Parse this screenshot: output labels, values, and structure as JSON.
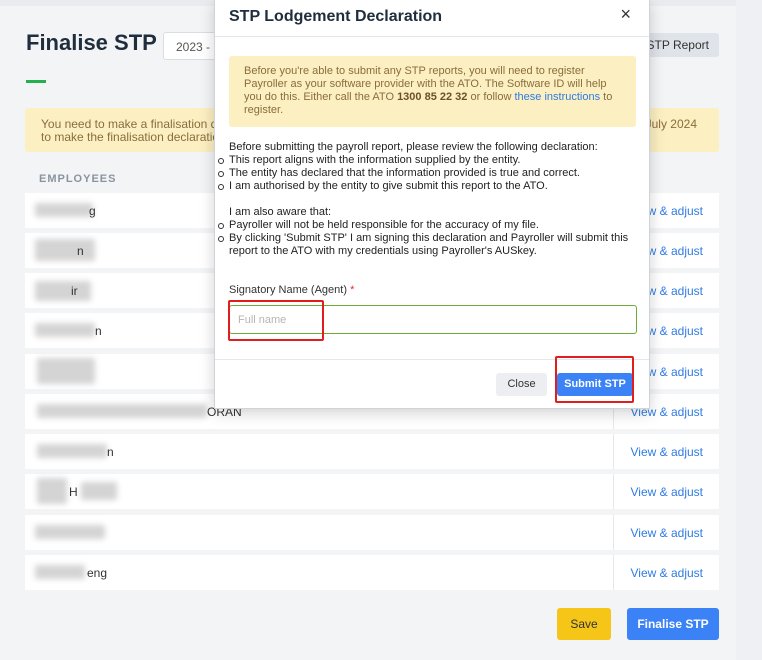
{
  "page": {
    "title": "Finalise STP",
    "year_select": "2023 -",
    "stp_report_label": "STP Report",
    "banner": {
      "line1": "You need to make a finalisation de",
      "line2": "to make the finalisation declaratio",
      "right_text": "July 2024"
    },
    "employees_header": "EMPLOYEES",
    "employees": [
      {
        "name": "g",
        "action": "View & adjust"
      },
      {
        "name": "n",
        "action": "View & adjust"
      },
      {
        "name": "ir",
        "action": "View & adjust"
      },
      {
        "name": "n",
        "action": "View & adjust"
      },
      {
        "name": "",
        "action": "View & adjust"
      },
      {
        "name": "ORAN",
        "action": "View & adjust"
      },
      {
        "name": "n",
        "action": "View & adjust"
      },
      {
        "name": "H",
        "action": "View & adjust"
      },
      {
        "name": "",
        "action": "View & adjust"
      },
      {
        "name": "eng",
        "action": "View & adjust"
      }
    ],
    "save_label": "Save",
    "finalise_label": "Finalise STP"
  },
  "modal": {
    "title": "STP Lodgement Declaration",
    "close_icon": "×",
    "info": {
      "text1": "Before you're able to submit any STP reports, you will need to register Payroller as your software provider with the ATO. The Software ID will help you do this. Either call the ATO ",
      "phone": "1300 85 22 32",
      "text2": " or follow ",
      "link": "these instructions",
      "text3": " to register."
    },
    "declaration": {
      "intro": "Before submitting the payroll report, please review the following declaration:",
      "items": [
        "This report aligns with the information supplied by the entity.",
        "The entity has declared that the information provided is true and correct.",
        "I am authorised by the entity to give submit this report to the ATO."
      ],
      "aware_intro": "I am also aware that:",
      "aware_items": [
        "Payroller will not be held responsible for the accuracy of my file.",
        "By clicking 'Submit STP' I am signing this declaration and Payroller will submit this report to the ATO with my credentials using Payroller's AUSkey."
      ]
    },
    "signatory_label": "Signatory Name (Agent)",
    "required_mark": "*",
    "signatory_placeholder": "Full name",
    "signatory_value": "",
    "close_label": "Close",
    "submit_label": "Submit STP"
  },
  "colors": {
    "accent_green": "#22b14c",
    "primary_blue": "#3b82f6",
    "warning_bg": "#fcefc2",
    "highlight_red": "#e11d1d",
    "save_yellow": "#f5c518"
  }
}
